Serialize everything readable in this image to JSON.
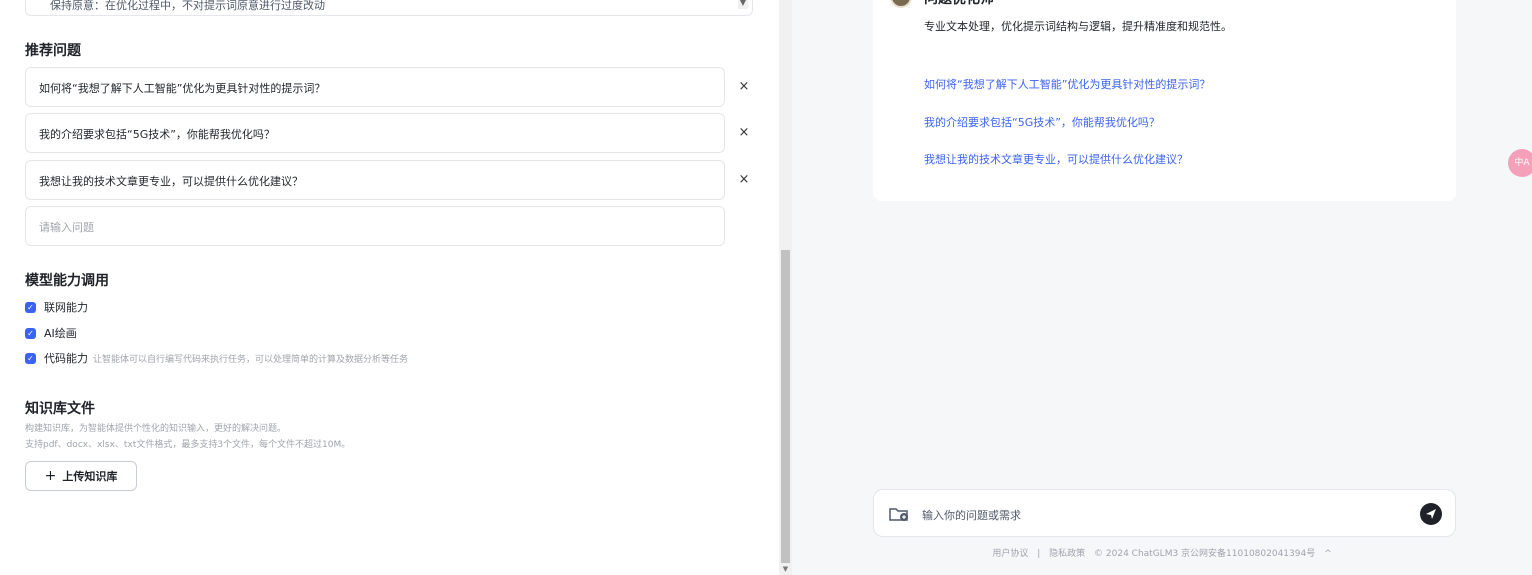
{
  "left": {
    "top_textarea": {
      "visible_text": "保持原意：在优化过程中，不对提示词原意进行过度改动"
    },
    "recommended": {
      "title": "推荐问题",
      "questions": [
        "如何将“我想了解下人工智能”优化为更具针对性的提示词？",
        "我的介绍要求包括“5G技术”，你能帮我优化吗？",
        "我想让我的技术文章更专业，可以提供什么优化建议？"
      ],
      "delete_label": "×",
      "input_placeholder": "请输入问题"
    },
    "capabilities": {
      "title": "模型能力调用",
      "items": [
        {
          "label": "联网能力",
          "desc": "",
          "checked": true
        },
        {
          "label": "AI绘画",
          "desc": "",
          "checked": true
        },
        {
          "label": "代码能力",
          "desc": "让智能体可以自行编写代码来执行任务，可以处理简单的计算及数据分析等任务",
          "checked": true
        }
      ]
    },
    "knowledge": {
      "title": "知识库文件",
      "desc1": "构建知识库，为智能体提供个性化的知识输入，更好的解决问题。",
      "desc2": "支持pdf、docx、xlsx、txt文件格式，最多支持3个文件，每个文件不超过10M。",
      "upload_label": "上传知识库"
    }
  },
  "preview": {
    "bot_name": "问题优化师",
    "bot_desc": "专业文本处理，优化提示词结构与逻辑，提升精准度和规范性。",
    "suggestions": [
      "如何将“我想了解下人工智能”优化为更具针对性的提示词？",
      "我的介绍要求包括“5G技术”，你能帮我优化吗？",
      "我想让我的技术文章更专业，可以提供什么优化建议？"
    ],
    "input_placeholder": "输入你的问题或需求",
    "footer": {
      "user_agreement": "用户协议",
      "sep": "|",
      "privacy": "隐私政策",
      "copyright": "© 2024 ChatGLM3 京公网安备11010802041394号",
      "chevron": "^"
    }
  },
  "float_button_label": "中A",
  "colors": {
    "accent": "#3b63f3",
    "link": "#3b63f3",
    "preview_bg": "#f6f7f9",
    "float_button": "#f4a0b8"
  },
  "icons": [
    "chevron-down-icon",
    "close-icon",
    "checkbox-checked-icon",
    "plus-icon",
    "folder-add-icon",
    "send-icon",
    "avatar"
  ]
}
